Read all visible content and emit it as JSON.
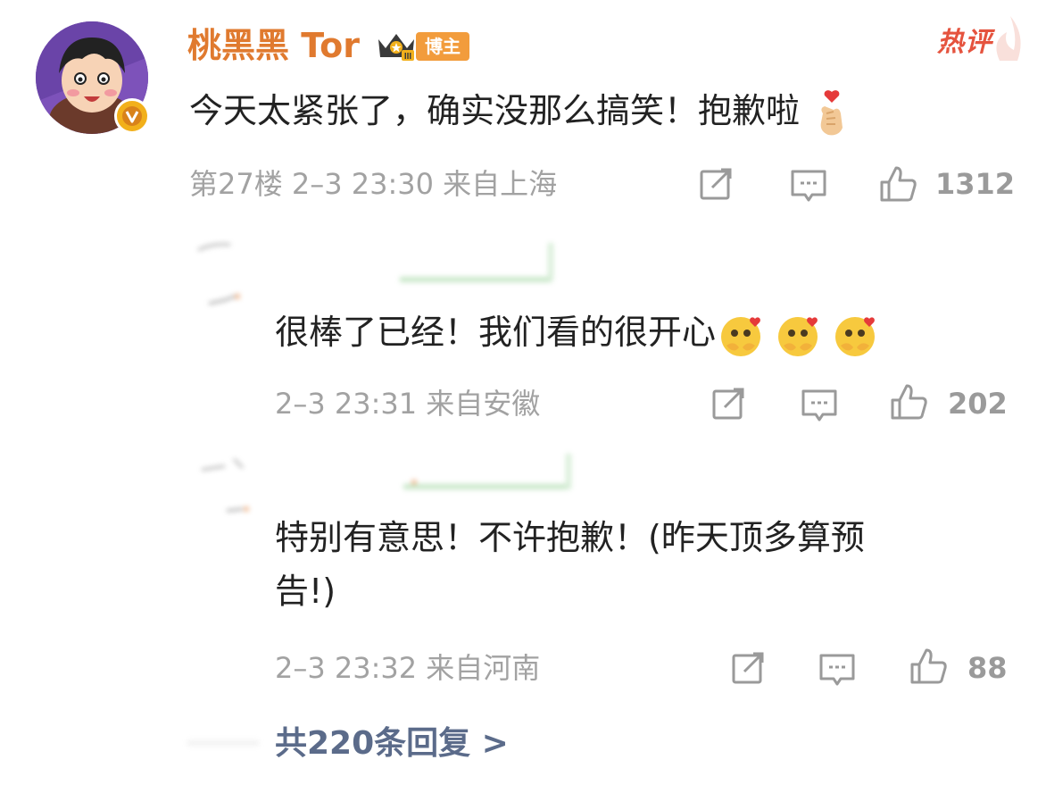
{
  "main_comment": {
    "author": "桃黑黑 Tor",
    "role_badge": "博主",
    "crown_level": "III",
    "hot_label": "热评",
    "text": "今天太紧张了，确实没那么搞笑！抱歉啦",
    "meta": "第27楼 2–3 23:30 来自上海",
    "like_count": "1312",
    "trailing_emoji": "finger-heart-emoji"
  },
  "replies": [
    {
      "text": "很棒了已经！我们看的很开心",
      "meta": "2–3 23:31 来自安徽",
      "like_count": "202",
      "emojis": [
        "shy-heart-emoji",
        "shy-heart-emoji",
        "shy-heart-emoji"
      ]
    },
    {
      "text_line1": "特别有意思！不许抱歉！(昨天顶多算预",
      "text_line2": "告!)",
      "meta": "2–3 23:32 来自河南",
      "like_count": "88"
    }
  ],
  "more_replies": "共220条回复 >",
  "icons": [
    "share-icon",
    "comment-icon",
    "like-icon",
    "verified-v-icon",
    "crown-icon"
  ],
  "colors": {
    "author": "#e07a2f",
    "badge_bg": "#f29c3c",
    "hot": "#e5533e",
    "meta": "#a2a2a2",
    "more_link": "#5b6b8a"
  }
}
